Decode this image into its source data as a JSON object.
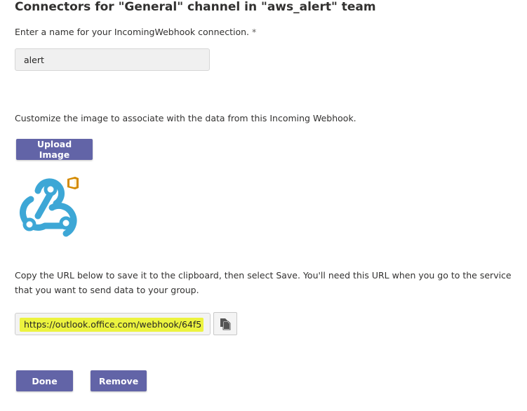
{
  "header": {
    "title": "Connectors for \"General\" channel in \"aws_alert\" team"
  },
  "name_section": {
    "label": "Enter a name for your IncomingWebhook connection.",
    "required_marker": " *",
    "value": "alert"
  },
  "image_section": {
    "label": "Customize the image to associate with the data from this Incoming Webhook.",
    "upload_button": "Upload Image",
    "logo_icon": "webhook-icon",
    "badge_icon": "office-icon",
    "colors": {
      "logo": "#3da7d6",
      "badge": "#d48a00"
    }
  },
  "url_section": {
    "label": "Copy the URL below to save it to the clipboard, then select Save. You'll need this URL when you go to the service that you want to send data to your group.",
    "url_value": "https://outlook.office.com/webhook/64f5",
    "copy_icon": "copy-icon",
    "highlight_color": "#ecf33f"
  },
  "footer": {
    "done_button": "Done",
    "remove_button": "Remove"
  },
  "theme": {
    "accent": "#6264a7"
  }
}
